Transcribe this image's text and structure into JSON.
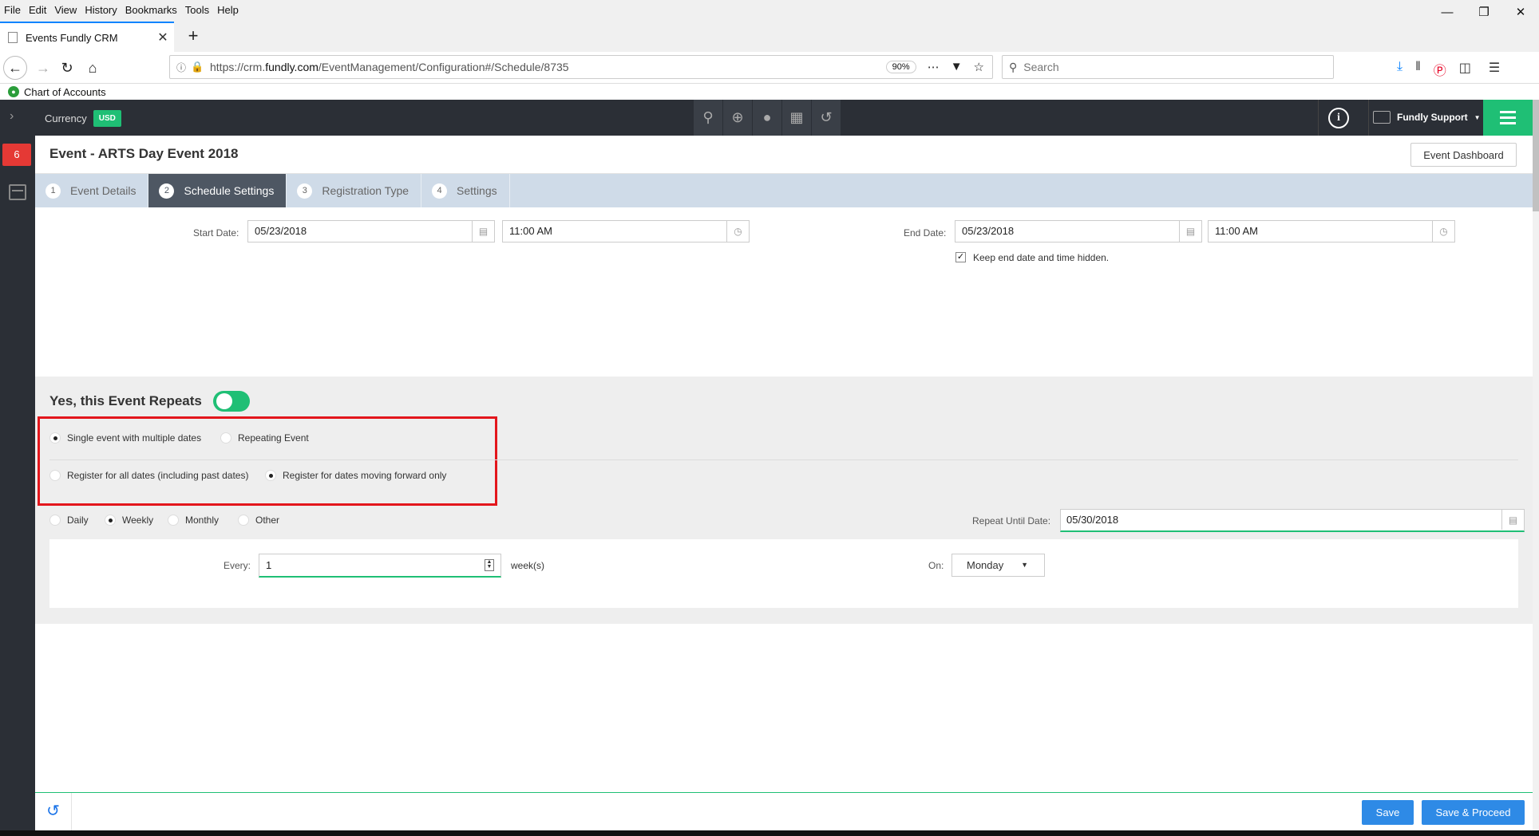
{
  "browser": {
    "menu": [
      "File",
      "Edit",
      "View",
      "History",
      "Bookmarks",
      "Tools",
      "Help"
    ],
    "tab_title": "Events Fundly CRM",
    "url_prefix": "https://crm.",
    "url_domain": "fundly.com",
    "url_path": "/EventManagement/Configuration#/Schedule/8735",
    "zoom": "90%",
    "search_placeholder": "Search",
    "bookmark": "Chart of Accounts"
  },
  "app": {
    "currency_label": "Currency",
    "currency_value": "USD",
    "user_menu": "Fundly Support",
    "notification_count": "6",
    "page_title": "Event - ARTS Day Event 2018",
    "dashboard_button": "Event Dashboard",
    "steps": [
      {
        "num": "1",
        "label": "Event Details",
        "active": false
      },
      {
        "num": "2",
        "label": "Schedule Settings",
        "active": true
      },
      {
        "num": "3",
        "label": "Registration Type",
        "active": false
      },
      {
        "num": "4",
        "label": "Settings",
        "active": false
      }
    ],
    "start_date_label": "Start Date:",
    "start_date": "05/23/2018",
    "start_time": "11:00 AM",
    "end_date_label": "End Date:",
    "end_date": "05/23/2018",
    "end_time": "11:00 AM",
    "keep_hidden_label": "Keep end date and time hidden.",
    "keep_hidden_checked": true,
    "repeats_title": "Yes, this Event Repeats",
    "repeats_on": true,
    "event_type_options": [
      {
        "label": "Single event with multiple dates",
        "selected": true
      },
      {
        "label": "Repeating Event",
        "selected": false
      }
    ],
    "register_options": [
      {
        "label": "Register for all dates (including past dates)",
        "selected": false
      },
      {
        "label": "Register for dates moving forward only",
        "selected": true
      }
    ],
    "frequency_options": [
      {
        "label": "Daily",
        "selected": false
      },
      {
        "label": "Weekly",
        "selected": true
      },
      {
        "label": "Monthly",
        "selected": false
      },
      {
        "label": "Other",
        "selected": false
      }
    ],
    "repeat_until_label": "Repeat Until Date:",
    "repeat_until": "05/30/2018",
    "every_label": "Every:",
    "every_value": "1",
    "every_unit": "week(s)",
    "on_label": "On:",
    "on_value": "Monday",
    "save_button": "Save",
    "save_proceed_button": "Save & Proceed"
  },
  "colors": {
    "accent_green": "#1fbf75",
    "nav_dark": "#2b2f36",
    "highlight_red": "#e3161c",
    "button_blue": "#2e8ae6"
  }
}
